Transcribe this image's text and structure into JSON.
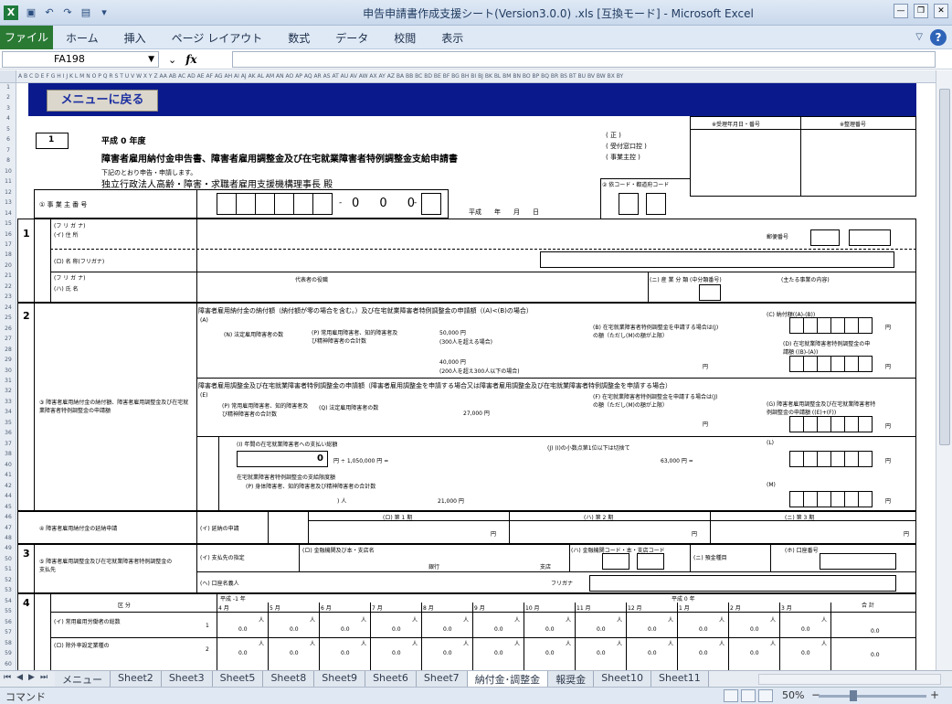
{
  "window": {
    "title": "申告申請書作成支援シート(Version3.0.0) .xls [互換モード] - Microsoft Excel"
  },
  "ribbon": {
    "file_tab": "ファイル",
    "tabs": [
      "ホーム",
      "挿入",
      "ページ レイアウト",
      "数式",
      "データ",
      "校閲",
      "表示"
    ]
  },
  "formula_bar": {
    "name_box": "FA198",
    "formula": ""
  },
  "column_letters": "A B C D E F G H I J K L M N O P Q R S T U V W X Y Z AA AB AC AD AE AF AG AH AI AJ AK AL AM AN AO AP AQ AR AS AT AU AV AW AX AY AZ BA BB BC BD BE BF BG BH BI BJ BK BL BM BN BO BP BQ BR BS BT BU BV BW BX BY",
  "row_numbers": [
    "1",
    "2",
    "3",
    "4",
    "5",
    "6",
    "7",
    "8",
    "10",
    "11",
    "12",
    "13",
    "14",
    "15",
    "16",
    "17",
    "18",
    "20",
    "21",
    "22",
    "23",
    "24",
    "25",
    "26",
    "27",
    "28",
    "29",
    "30",
    "31",
    "32",
    "33",
    "34",
    "35",
    "36",
    "37",
    "38",
    "40",
    "41",
    "42",
    "44",
    "45",
    "46",
    "47",
    "48",
    "49",
    "50",
    "51",
    "52",
    "53",
    "54",
    "55",
    "56",
    "57",
    "58",
    "59",
    "60"
  ],
  "form": {
    "menu_button": "メニューに戻る",
    "number_box": "1",
    "year_line": "平成 0 年度",
    "form_title": "障害者雇用納付金申告書、障害者雇用調整金及び在宅就業障害者特例調整金支給申請書",
    "declaration": "下記のとおり申告・申請します。",
    "addressee": "独立行政法人高齢・障害・求職者雇用支援機構理事長 殿",
    "copy_labels": [
      "( 正 )",
      "( 受付窓口控 )",
      "( 事業主控 )"
    ],
    "receipt_date_label": "※受理年月日・番号",
    "processing_no_label": "※整理番号",
    "employer_no_label": "① 事 業 主 番 号",
    "employer_no_digits": "0 0 0",
    "date_label": "平成　　年　　月　　日",
    "industry_code_label": "② 依コード・都道府コード",
    "section_1": "1",
    "furigana_label": "(フ リ ガ ナ)",
    "address_label": "(イ) 住 所",
    "postal_label": "郵便番号",
    "name_label": "(ロ) 名 称(フリガナ)",
    "rep_label": "(ハ) 氏 名",
    "rep_title_label": "代表者の役職",
    "industry_class_label": "(ニ) 産 業 分 類",
    "industry_no_label": "(中分類番号)",
    "main_business_label": "(主たる事業の内容)",
    "section_2": "2",
    "sec2_title": "障害者雇用納付金の納付額（納付額が零の場合を含む。）及び在宅就業障害者特例調整金の申請額（(A)<(B)の場合）",
    "sec2_left_label": "③ 障害者雇用納付金の納付額、障害者雇用調整金及び在宅就業障害者特例調整金の申請額",
    "a_label": "(A)",
    "n_label": "(N) 法定雇用障害者の数",
    "p_label": "(P) 常用雇用障害者、知的障害者及び精神障害者の合計数",
    "amount_50000": "50,000 円",
    "note_300_over": "(300人を超える場合)",
    "amount_40000": "40,000 円",
    "note_300_under": "(200人を超え300人以下の場合)",
    "b_label": "(B) 在宅就業障害者特例調整金を申請する場合は(J)の額（ただし(M)の額が上限）",
    "c_label": "(C) 納付額((A)-(B))",
    "d_label": "(D) 在宅就業障害者特例調整金の申請額 ((B)-(A))",
    "yen": "円",
    "sec2b_title": "障害者雇用調整金及び在宅就業障害者特例調整金の申請額（障害者雇用調整金を申請する場合又は障害者雇用調整金及び在宅就業障害者特例調整金を申請する場合）",
    "e_label": "(E)",
    "q_label": "(Q) 法定雇用障害者の数",
    "amount_27000": "27,000 円",
    "f_label": "(F) 在宅就業障害者特例調整金を申請する場合は(J)の額（ただし(M)の額が上限）",
    "g_label": "(G) 障害者雇用調整金及び在宅就業障害者特例調整金の申請額 ((E)+(F))",
    "i_label": "(I) 年間の在宅就業障害者への支払い総額",
    "i_value": "0",
    "div_label": "円 ÷ 1,050,000 円 =",
    "j_label": "(J) (I)の小数点第1位以下は切捨て",
    "amount_63000": "63,000 円 =",
    "l_label": "(L)",
    "m_label": "(M)",
    "home_worker_label": "在宅就業障害者特例調整金の支給限度額",
    "p2_label": "(P) 身体障害者、知的障害者及び精神障害者の合計数",
    "persons_label": ") 人",
    "amount_21000": "21,000 円",
    "sec_3rd_label": "④ 障害者雇用納付金の延納申請",
    "installment_label": "(イ) 延納の申請",
    "period_1": "(ロ) 第 1 期",
    "period_2": "(ハ) 第 2 期",
    "period_3": "(ニ) 第 3 期",
    "section_3": "3",
    "payee_label": "⑤ 障害者雇用調整金及び在宅就業障害者特例調整金の支払先",
    "transfer_label": "(イ) 支払先の指定",
    "bank_label": "(ロ) 金融機関及び本・支店名",
    "bank_code_label": "(ハ) 金融機関コード・本・支店コード",
    "deposit_type_label": "(ニ) 預金種目",
    "account_no_label": "(ホ) 口座番号",
    "bank_suffix": "銀行",
    "branch_suffix": "支店",
    "account_name_label": "(ヘ) 口座名義人",
    "furigana2": "フリガナ",
    "section_4": "4",
    "category_label": "区 分",
    "year_prev": "平成 -1 年",
    "year_cur": "平成 0 年",
    "total_label": "合 計",
    "months": [
      "4 月",
      "5 月",
      "6 月",
      "7 月",
      "8 月",
      "9 月",
      "10 月",
      "11 月",
      "12 月",
      "1 月",
      "2 月",
      "3 月"
    ],
    "row1_label": "(イ) 常用雇用労働者の総数",
    "row2_label": "(ロ) 除外率設定業種の",
    "person_unit": "人",
    "zero_val": "0.0",
    "total_zero": "0.0"
  },
  "sheet_tabs": [
    "メニュー",
    "Sheet2",
    "Sheet3",
    "Sheet5",
    "Sheet8",
    "Sheet9",
    "Sheet6",
    "Sheet7",
    "納付金･調整金",
    "報奨金",
    "Sheet10",
    "Sheet11"
  ],
  "active_sheet": "納付金･調整金",
  "status": {
    "mode": "コマンド",
    "zoom": "50%"
  }
}
